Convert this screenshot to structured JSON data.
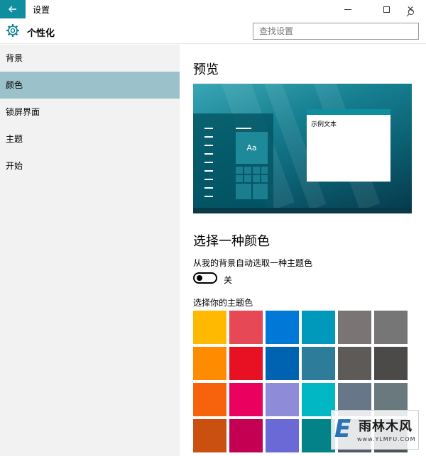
{
  "window": {
    "title": "设置",
    "back_icon": "back-arrow-icon",
    "minimize_icon": "minimize-icon",
    "maximize_icon": "maximize-icon",
    "close_glyph": "✕"
  },
  "header": {
    "section_icon": "gear-icon",
    "section_title": "个性化",
    "search_placeholder": "查找设置",
    "search_icon": "search-icon"
  },
  "sidebar": {
    "items": [
      {
        "label": "背景",
        "active": false
      },
      {
        "label": "颜色",
        "active": true
      },
      {
        "label": "锁屏界面",
        "active": false
      },
      {
        "label": "主题",
        "active": false
      },
      {
        "label": "开始",
        "active": false
      }
    ]
  },
  "main": {
    "preview_heading": "预览",
    "preview": {
      "tile_label": "Aa",
      "sample_text": "示例文本"
    },
    "choose_heading": "选择一种颜色",
    "auto_pick_label": "从我的背景自动选取一种主题色",
    "toggle_state": "关",
    "toggle_on": false,
    "accent_label": "选择你的主题色",
    "swatches": [
      [
        "#ffb900",
        "#e74856",
        "#0078d7",
        "#0099bc",
        "#7a7574",
        "#767676"
      ],
      [
        "#ff8c00",
        "#e81123",
        "#0063b1",
        "#2d7d9a",
        "#5d5a58",
        "#4c4a48"
      ],
      [
        "#f7630c",
        "#ea005e",
        "#8e8cd8",
        "#00b7c3",
        "#68768a",
        "#69797e"
      ],
      [
        "#ca5010",
        "#c30052",
        "#6b69d6",
        "#038387",
        "#515c6b",
        "#4a5459"
      ]
    ]
  },
  "watermark": {
    "logo_letter": "E",
    "name": "雨林木风",
    "url": "www.YLMFU.COM"
  }
}
